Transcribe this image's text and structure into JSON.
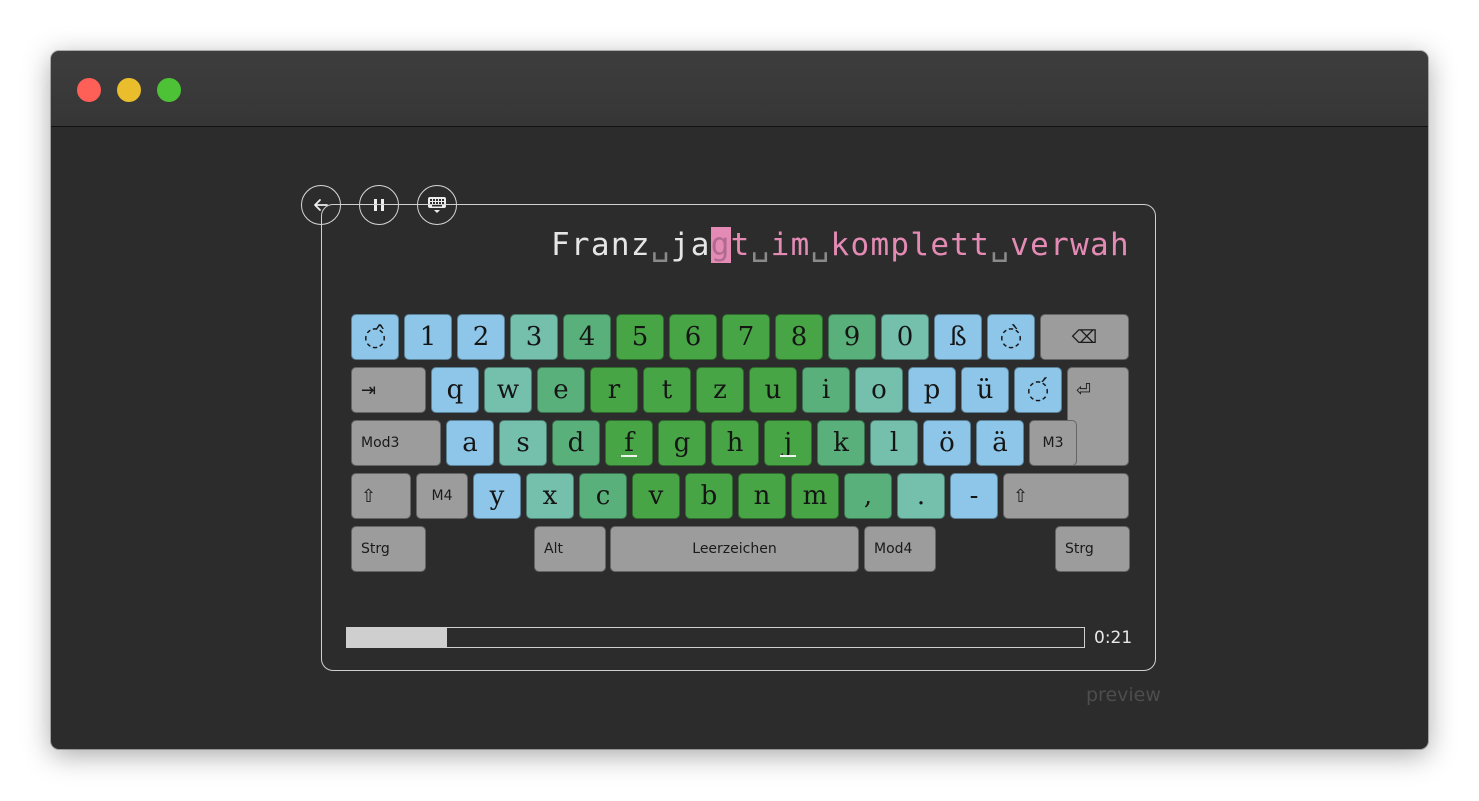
{
  "window": {
    "buttons": [
      "close",
      "minimize",
      "maximize"
    ]
  },
  "controls": {
    "back_icon": "arrow-left-icon",
    "pause_icon": "pause-icon",
    "keyboard_icon": "keyboard-icon"
  },
  "text_line": {
    "typed": "Franz␣ja",
    "cursor": "g",
    "pending": "t␣im␣komplett␣verwah"
  },
  "keyboard": {
    "colors": {
      "blue": "#8dc6e8",
      "teal": "#75bfad",
      "midgreen": "#5ab07a",
      "green": "#48a546",
      "gray": "#9c9c9c"
    },
    "rows": [
      {
        "keys": [
          {
            "label": "◌̂",
            "color": "blue"
          },
          {
            "label": "1",
            "color": "blue"
          },
          {
            "label": "2",
            "color": "blue"
          },
          {
            "label": "3",
            "color": "teal"
          },
          {
            "label": "4",
            "color": "midgreen"
          },
          {
            "label": "5",
            "color": "green"
          },
          {
            "label": "6",
            "color": "green"
          },
          {
            "label": "7",
            "color": "green"
          },
          {
            "label": "8",
            "color": "green"
          },
          {
            "label": "9",
            "color": "midgreen"
          },
          {
            "label": "0",
            "color": "teal"
          },
          {
            "label": "ß",
            "color": "blue"
          },
          {
            "label": "◌̀",
            "color": "blue"
          },
          {
            "label": "⌫",
            "color": "gray"
          }
        ]
      },
      {
        "keys": [
          {
            "label": "⇥",
            "color": "gray"
          },
          {
            "label": "q",
            "color": "blue"
          },
          {
            "label": "w",
            "color": "teal"
          },
          {
            "label": "e",
            "color": "midgreen"
          },
          {
            "label": "r",
            "color": "green"
          },
          {
            "label": "t",
            "color": "green"
          },
          {
            "label": "z",
            "color": "green"
          },
          {
            "label": "u",
            "color": "green"
          },
          {
            "label": "i",
            "color": "midgreen"
          },
          {
            "label": "o",
            "color": "teal"
          },
          {
            "label": "p",
            "color": "blue"
          },
          {
            "label": "ü",
            "color": "blue"
          },
          {
            "label": "◌́",
            "color": "blue"
          },
          {
            "label": "⏎",
            "color": "gray"
          }
        ]
      },
      {
        "keys": [
          {
            "label": "Mod3",
            "color": "gray"
          },
          {
            "label": "a",
            "color": "blue"
          },
          {
            "label": "s",
            "color": "teal"
          },
          {
            "label": "d",
            "color": "midgreen"
          },
          {
            "label": "f",
            "color": "green",
            "homing": true
          },
          {
            "label": "g",
            "color": "green"
          },
          {
            "label": "h",
            "color": "green"
          },
          {
            "label": "j",
            "color": "green",
            "homing": true
          },
          {
            "label": "k",
            "color": "midgreen"
          },
          {
            "label": "l",
            "color": "teal"
          },
          {
            "label": "ö",
            "color": "blue"
          },
          {
            "label": "ä",
            "color": "blue"
          },
          {
            "label": "M3",
            "color": "gray"
          }
        ]
      },
      {
        "keys": [
          {
            "label": "⇧",
            "color": "gray"
          },
          {
            "label": "M4",
            "color": "gray"
          },
          {
            "label": "y",
            "color": "blue"
          },
          {
            "label": "x",
            "color": "teal"
          },
          {
            "label": "c",
            "color": "midgreen"
          },
          {
            "label": "v",
            "color": "green"
          },
          {
            "label": "b",
            "color": "green"
          },
          {
            "label": "n",
            "color": "green"
          },
          {
            "label": "m",
            "color": "green"
          },
          {
            "label": ",",
            "color": "midgreen"
          },
          {
            "label": ".",
            "color": "teal"
          },
          {
            "label": "-",
            "color": "blue"
          },
          {
            "label": "⇧",
            "color": "gray"
          }
        ]
      },
      {
        "keys": [
          {
            "label": "Strg",
            "color": "gray"
          },
          {
            "label": "Alt",
            "color": "gray"
          },
          {
            "label": "Leerzeichen",
            "color": "gray"
          },
          {
            "label": "Mod4",
            "color": "gray"
          },
          {
            "label": "Strg",
            "color": "gray"
          }
        ]
      }
    ]
  },
  "progress": {
    "fraction": 0.136,
    "time": "0:21"
  },
  "footer": {
    "preview_label": "preview"
  }
}
